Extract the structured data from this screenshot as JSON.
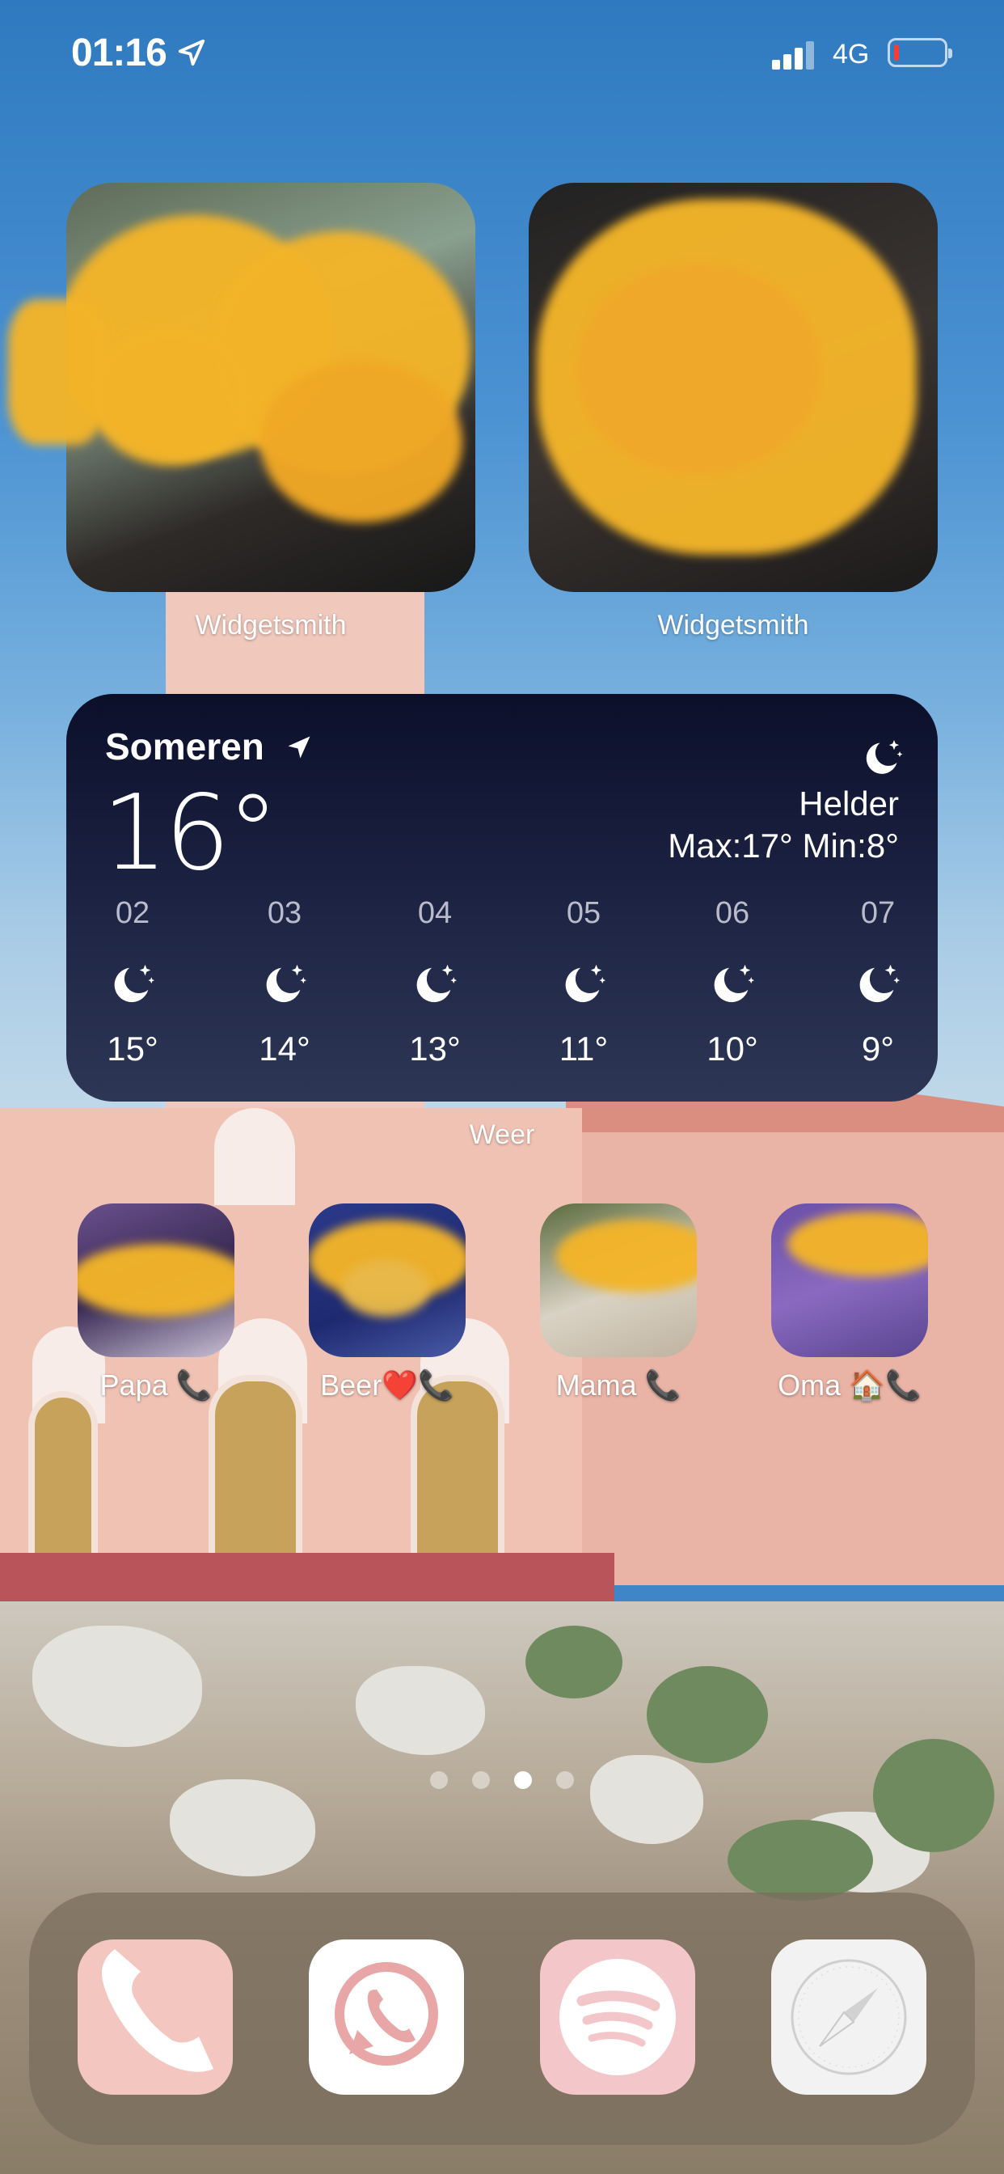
{
  "status_bar": {
    "time": "01:16",
    "network": "4G",
    "battery_level": 0.1,
    "battery_color": "#ff3b30"
  },
  "photo_widgets": [
    {
      "label": "Widgetsmith"
    },
    {
      "label": "Widgetsmith"
    }
  ],
  "weather_widget": {
    "location": "Someren",
    "current_temp": "16°",
    "condition": "Helder",
    "range": "Max:17° Min:8°",
    "condition_icon": "moon-stars-icon",
    "hourly": [
      {
        "hour": "02",
        "temp": "15°"
      },
      {
        "hour": "03",
        "temp": "14°"
      },
      {
        "hour": "04",
        "temp": "13°"
      },
      {
        "hour": "05",
        "temp": "11°"
      },
      {
        "hour": "06",
        "temp": "10°"
      },
      {
        "hour": "07",
        "temp": "9°"
      }
    ],
    "label": "Weer"
  },
  "contacts": [
    {
      "label": "Papa 📞"
    },
    {
      "label": "Beer❤️📞"
    },
    {
      "label": "Mama 📞"
    },
    {
      "label": "Oma 🏠📞"
    }
  ],
  "page_dots": {
    "count": 4,
    "active_index": 2
  },
  "dock": {
    "apps": [
      {
        "icon": "phone-icon",
        "color": "#f3c7bf"
      },
      {
        "icon": "whatsapp-icon",
        "color": "#ffffff"
      },
      {
        "icon": "spotify-icon",
        "color": "#f3c7c9"
      },
      {
        "icon": "compass-icon",
        "color": "#f2f2f2"
      }
    ]
  }
}
